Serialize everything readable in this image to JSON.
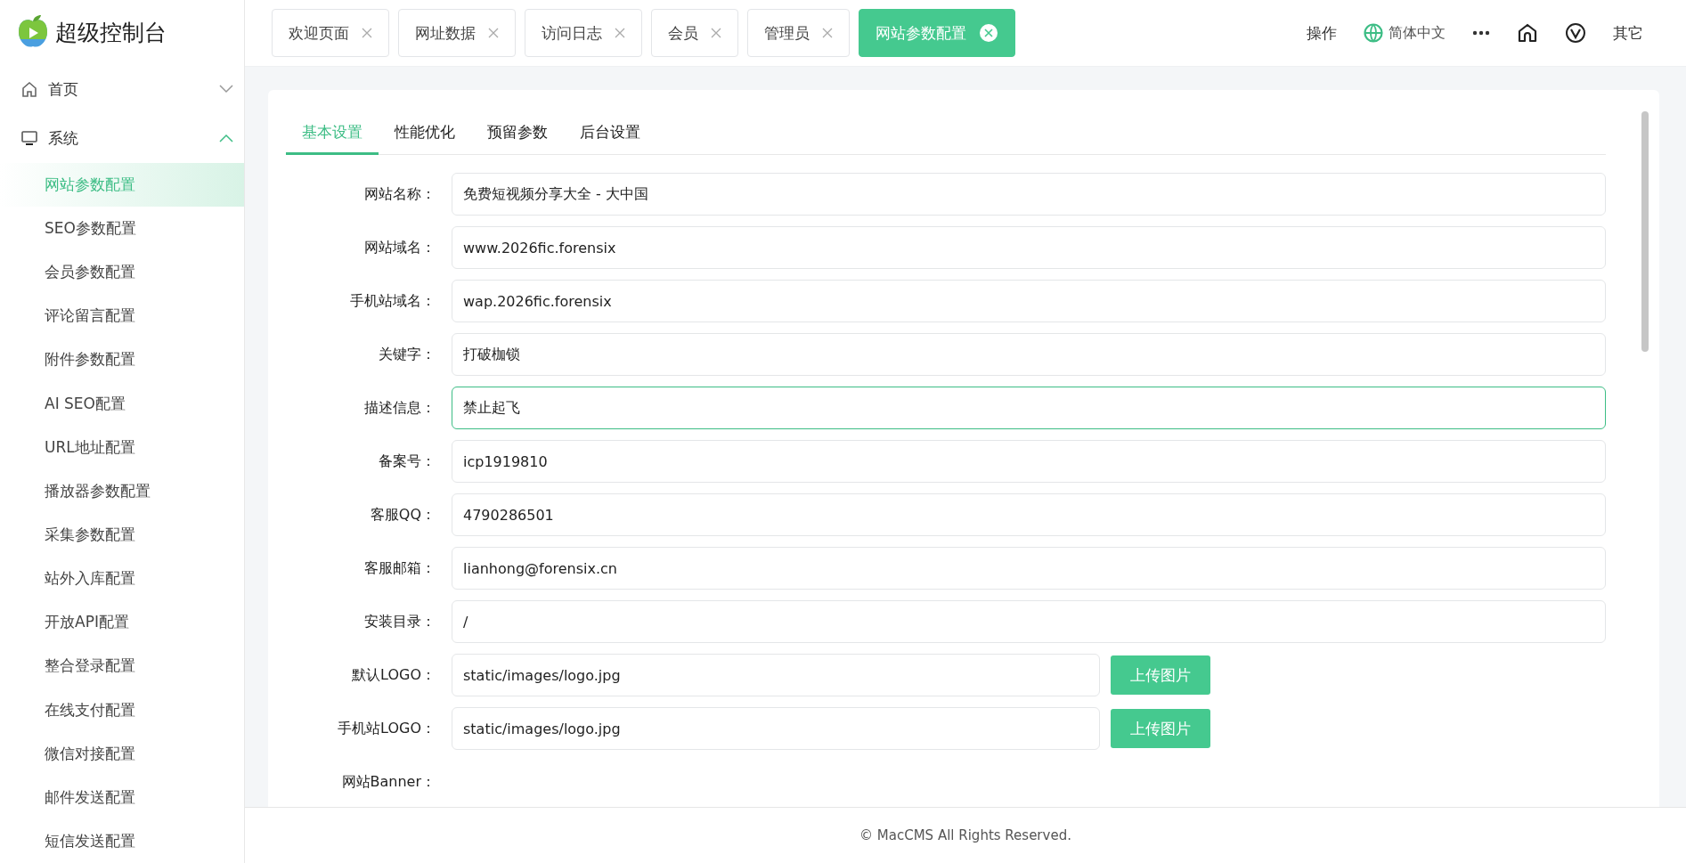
{
  "brand": {
    "title": "超级控制台"
  },
  "sidebar": {
    "groups": [
      {
        "label": "首页",
        "expanded": false
      },
      {
        "label": "系统",
        "expanded": true,
        "children": [
          {
            "label": "网站参数配置",
            "selected": true
          },
          {
            "label": "SEO参数配置",
            "selected": false
          },
          {
            "label": "会员参数配置",
            "selected": false
          },
          {
            "label": "评论留言配置",
            "selected": false
          },
          {
            "label": "附件参数配置",
            "selected": false
          },
          {
            "label": "AI SEO配置",
            "selected": false
          },
          {
            "label": "URL地址配置",
            "selected": false
          },
          {
            "label": "播放器参数配置",
            "selected": false
          },
          {
            "label": "采集参数配置",
            "selected": false
          },
          {
            "label": "站外入库配置",
            "selected": false
          },
          {
            "label": "开放API配置",
            "selected": false
          },
          {
            "label": "整合登录配置",
            "selected": false
          },
          {
            "label": "在线支付配置",
            "selected": false
          },
          {
            "label": "微信对接配置",
            "selected": false
          },
          {
            "label": "邮件发送配置",
            "selected": false
          },
          {
            "label": "短信发送配置",
            "selected": false
          }
        ]
      }
    ]
  },
  "page_tabs": [
    {
      "label": "欢迎页面",
      "selected": false
    },
    {
      "label": "网址数据",
      "selected": false
    },
    {
      "label": "访问日志",
      "selected": false
    },
    {
      "label": "会员",
      "selected": false
    },
    {
      "label": "管理员",
      "selected": false
    },
    {
      "label": "网站参数配置",
      "selected": true
    }
  ],
  "header_actions": {
    "operate": "操作",
    "language": "简体中文",
    "more": "其它"
  },
  "form_tabs": [
    {
      "label": "基本设置",
      "selected": true
    },
    {
      "label": "性能优化",
      "selected": false
    },
    {
      "label": "预留参数",
      "selected": false
    },
    {
      "label": "后台设置",
      "selected": false
    }
  ],
  "fields": [
    {
      "kind": "text",
      "label": "网站名称：",
      "value": "免费短视频分享大全 - 大中国",
      "focused": false
    },
    {
      "kind": "text",
      "label": "网站域名：",
      "value": "www.2026fic.forensix",
      "focused": false
    },
    {
      "kind": "text",
      "label": "手机站域名：",
      "value": "wap.2026fic.forensix",
      "focused": false
    },
    {
      "kind": "text",
      "label": "关键字：",
      "value": "打破枷锁",
      "focused": false
    },
    {
      "kind": "text",
      "label": "描述信息：",
      "value": "禁止起飞",
      "focused": true
    },
    {
      "kind": "text",
      "label": "备案号：",
      "value": "icp1919810",
      "focused": false
    },
    {
      "kind": "text",
      "label": "客服QQ：",
      "value": "4790286501",
      "focused": false
    },
    {
      "kind": "text",
      "label": "客服邮箱：",
      "value": "lianhong@forensix.cn",
      "focused": false
    },
    {
      "kind": "text",
      "label": "安装目录：",
      "value": "/",
      "focused": false
    },
    {
      "kind": "upload",
      "label": "默认LOGO：",
      "value": "static/images/logo.jpg",
      "button": "上传图片",
      "focused": false
    },
    {
      "kind": "upload",
      "label": "手机站LOGO：",
      "value": "static/images/logo.jpg",
      "button": "上传图片",
      "focused": false
    },
    {
      "kind": "banner",
      "label": "网站Banner："
    }
  ],
  "footer": "© MacCMS All Rights Reserved."
}
